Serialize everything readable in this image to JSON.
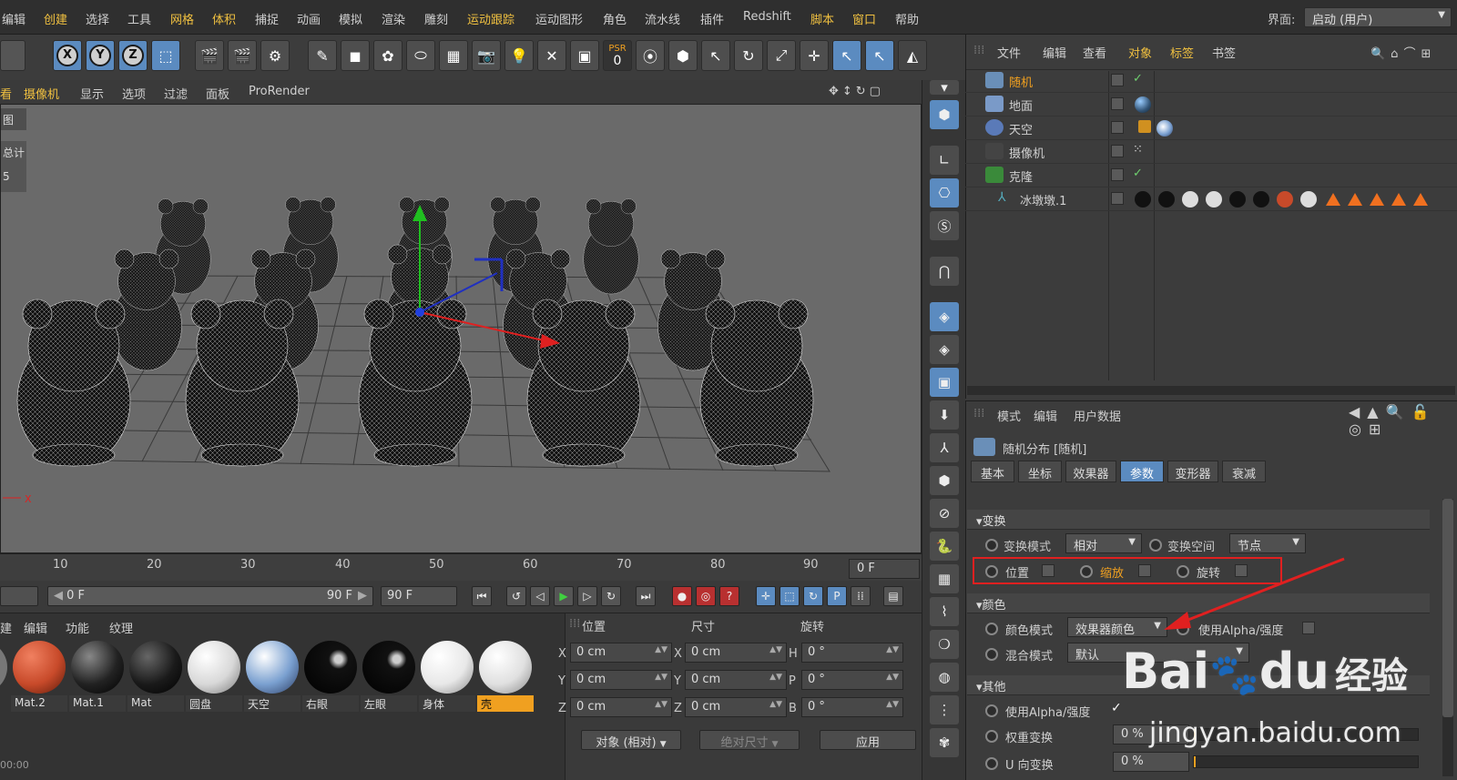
{
  "menubar": {
    "items": [
      "编辑",
      "创建",
      "选择",
      "工具",
      "网格",
      "体积",
      "捕捉",
      "动画",
      "模拟",
      "渲染",
      "雕刻",
      "运动跟踪",
      "运动图形",
      "角色",
      "流水线",
      "插件",
      "Redshift",
      "脚本",
      "窗口",
      "帮助"
    ],
    "layout_label": "界面:",
    "layout_value": "启动 (用户)"
  },
  "toolbar": {
    "axis_x": "X",
    "axis_y": "Y",
    "axis_z": "Z",
    "psr_label": "PSR",
    "psr_value": "0"
  },
  "viewport": {
    "menu": [
      "看",
      "摄像机",
      "显示",
      "选项",
      "过滤",
      "面板",
      "ProRender"
    ],
    "side_labels": [
      "图",
      "总计",
      "5"
    ],
    "axis_label": "X"
  },
  "timeline": {
    "ticks": [
      "10",
      "20",
      "30",
      "40",
      "50",
      "60",
      "70",
      "80",
      "90"
    ],
    "current_frame": "0 F",
    "start_field": "0 F",
    "range_start": "0 F",
    "range_end": "90 F",
    "end_field": "90 F"
  },
  "materials": {
    "menu": [
      "建",
      "编辑",
      "功能",
      "纹理"
    ],
    "items": [
      {
        "name": "Mat.2",
        "color": "#c84a2a"
      },
      {
        "name": "Mat.1",
        "color": "#222222"
      },
      {
        "name": "Mat",
        "color": "#1a1a1a"
      },
      {
        "name": "圆盘",
        "color": "#d8d8d8"
      },
      {
        "name": "天空",
        "color": "#7aa0d0"
      },
      {
        "name": "右眼",
        "color": "#111111"
      },
      {
        "name": "左眼",
        "color": "#111111"
      },
      {
        "name": "身体",
        "color": "#e8e8e8"
      },
      {
        "name": "壳",
        "color": "#e0e0e0"
      }
    ],
    "selected": "壳"
  },
  "coords": {
    "headers": [
      "位置",
      "尺寸",
      "旋转"
    ],
    "rows": [
      {
        "a1": "X",
        "v1": "0 cm",
        "a2": "X",
        "v2": "0 cm",
        "a3": "H",
        "v3": "0 °"
      },
      {
        "a1": "Y",
        "v1": "0 cm",
        "a2": "Y",
        "v2": "0 cm",
        "a3": "P",
        "v3": "0 °"
      },
      {
        "a1": "Z",
        "v1": "0 cm",
        "a2": "Z",
        "v2": "0 cm",
        "a3": "B",
        "v3": "0 °"
      }
    ],
    "mode": "对象 (相对)",
    "size_mode": "绝对尺寸",
    "apply": "应用",
    "status": "00:00"
  },
  "objects": {
    "menu": [
      "文件",
      "编辑",
      "查看",
      "对象",
      "标签",
      "书签"
    ],
    "rows": [
      {
        "name": "随机",
        "highlight": true
      },
      {
        "name": "地面",
        "highlight": false
      },
      {
        "name": "天空",
        "highlight": false
      },
      {
        "name": "摄像机",
        "highlight": false
      },
      {
        "name": "克隆",
        "highlight": false
      },
      {
        "name": "冰墩墩.1",
        "highlight": false
      }
    ]
  },
  "attributes": {
    "menu": [
      "模式",
      "编辑",
      "用户数据"
    ],
    "title": "随机分布 [随机]",
    "tabs": [
      "基本",
      "坐标",
      "效果器",
      "参数",
      "变形器",
      "衰减"
    ],
    "active_tab": "参数",
    "transform_section": "▾变换",
    "transform_mode_label": "变换模式",
    "transform_mode_value": "相对",
    "transform_space_label": "变换空间",
    "transform_space_value": "节点",
    "position_label": "位置",
    "scale_label": "缩放",
    "rotation_label": "旋转",
    "color_section": "▾颜色",
    "color_mode_label": "颜色模式",
    "color_mode_value": "效果器颜色",
    "use_alpha_label": "使用Alpha/强度",
    "blend_mode_label": "混合模式",
    "blend_mode_value": "默认",
    "other_section": "▾其他",
    "other_alpha_label": "使用Alpha/强度",
    "weight_label": "权重变换",
    "weight_value": "0 %",
    "u_label": "U 向变换",
    "u_value": "0 %"
  },
  "watermark": {
    "brand": "Bai",
    "brand2": "du",
    "brand3": "经验",
    "url": "jingyan.baidu.com"
  },
  "colors": {
    "accent": "#5b8bc0",
    "highlight": "#f0c040",
    "annotation": "#e02020"
  }
}
